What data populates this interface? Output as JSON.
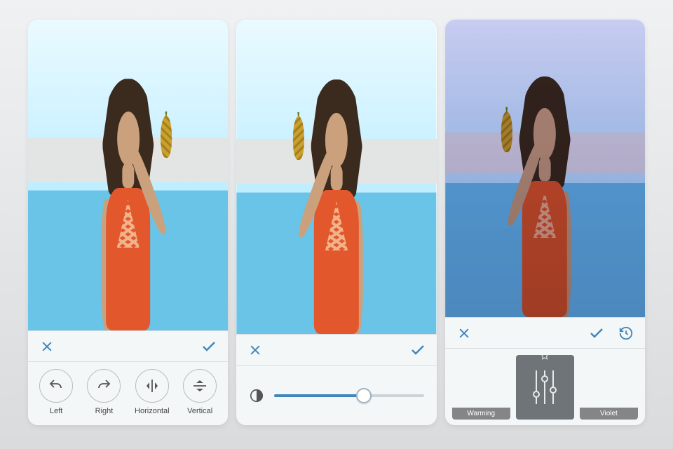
{
  "colors": {
    "accent": "#3f86bd",
    "panel": "#e9edef"
  },
  "screens": {
    "rotate": {
      "cancel_icon": "close-icon",
      "confirm_icon": "check-icon",
      "tools": [
        {
          "id": "rotate-left",
          "label": "Left",
          "icon": "undo-icon"
        },
        {
          "id": "rotate-right",
          "label": "Right",
          "icon": "redo-icon"
        },
        {
          "id": "flip-horizontal",
          "label": "Horizontal",
          "icon": "flip-h-icon"
        },
        {
          "id": "flip-vertical",
          "label": "Vertical",
          "icon": "flip-v-icon"
        }
      ]
    },
    "adjust": {
      "cancel_icon": "close-icon",
      "confirm_icon": "check-icon",
      "tool_icon": "contrast-icon",
      "slider": {
        "min": 0,
        "max": 100,
        "value": 60
      }
    },
    "filters": {
      "cancel_icon": "close-icon",
      "confirm_icon": "check-icon",
      "history_icon": "history-icon",
      "items": [
        {
          "id": "filter-warming",
          "label": "Warming",
          "starred": false
        },
        {
          "id": "filter-adjust",
          "label": "",
          "starred": true,
          "is_adjust_tile": true
        },
        {
          "id": "filter-violet",
          "label": "Violet",
          "starred": false
        }
      ]
    }
  }
}
